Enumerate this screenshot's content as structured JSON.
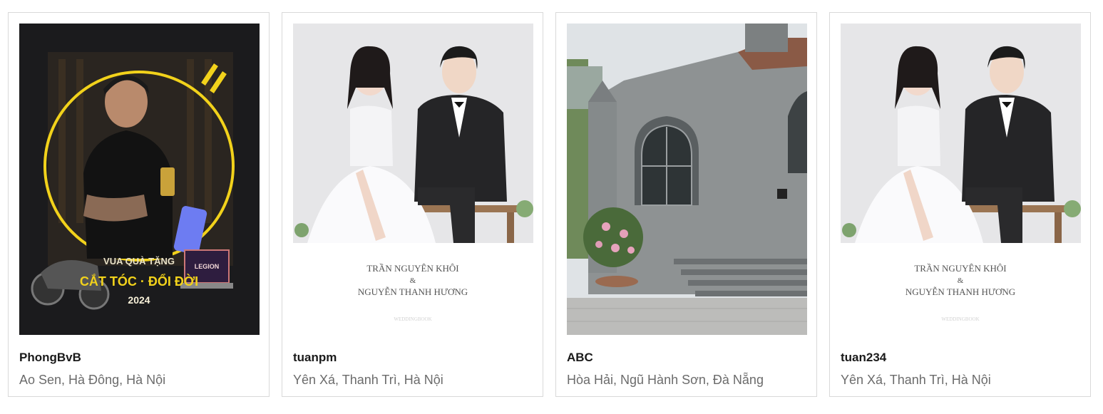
{
  "cards": [
    {
      "name": "PhongBvB",
      "address": "Ao Sen, Hà Đông, Hà Nội",
      "image": {
        "subject": "promo-poster",
        "poster_line1": "VUA QUÀ TẶNG",
        "poster_line2": "CẮT TÓC · ĐỔI ĐỜI",
        "poster_line3": "2024",
        "laptop_label": "LEGION"
      }
    },
    {
      "name": "tuanpm",
      "address": "Yên Xá, Thanh Trì, Hà Nội",
      "image": {
        "subject": "wedding-card",
        "line1": "TRẦN NGUYÊN KHÔI",
        "amp": "&",
        "line2": "NGUYỄN THANH HƯƠNG",
        "brand": "WEDDINGBOOK"
      }
    },
    {
      "name": "ABC",
      "address": "Hòa Hải, Ngũ Hành Sơn, Đà Nẵng",
      "image": {
        "subject": "old-church-photo"
      }
    },
    {
      "name": "tuan234",
      "address": "Yên Xá, Thanh Trì, Hà Nội",
      "image": {
        "subject": "wedding-card",
        "line1": "TRẦN NGUYÊN KHÔI",
        "amp": "&",
        "line2": "NGUYỄN THANH HƯƠNG",
        "brand": "WEDDINGBOOK"
      }
    }
  ],
  "colors": {
    "card_border": "#d9d9d9",
    "name_text": "#1a1a1a",
    "address_text": "#6b6b6b",
    "poster_ring": "#f2d21b"
  }
}
